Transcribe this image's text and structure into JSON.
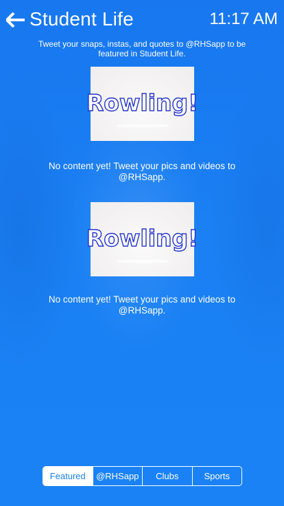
{
  "header": {
    "title": "Student Life",
    "time": "11:17 AM",
    "back_icon": "arrow-left-icon"
  },
  "intro": "Tweet your snaps, instas, and quotes to @RHSapp to be featured in Student Life.",
  "feed": [
    {
      "image_text": "Rowling!",
      "message": "No content yet! Tweet your pics and videos to @RHSapp."
    },
    {
      "image_text": "Rowling!",
      "message": "No content yet! Tweet your pics and videos to @RHSapp."
    }
  ],
  "tabs": [
    {
      "label": "Featured",
      "active": true
    },
    {
      "label": "@RHSapp",
      "active": false
    },
    {
      "label": "Clubs",
      "active": false
    },
    {
      "label": "Sports",
      "active": false
    }
  ],
  "colors": {
    "background": "#1a7ff0",
    "text": "#ffffff",
    "logo_outline": "#2233c8"
  }
}
